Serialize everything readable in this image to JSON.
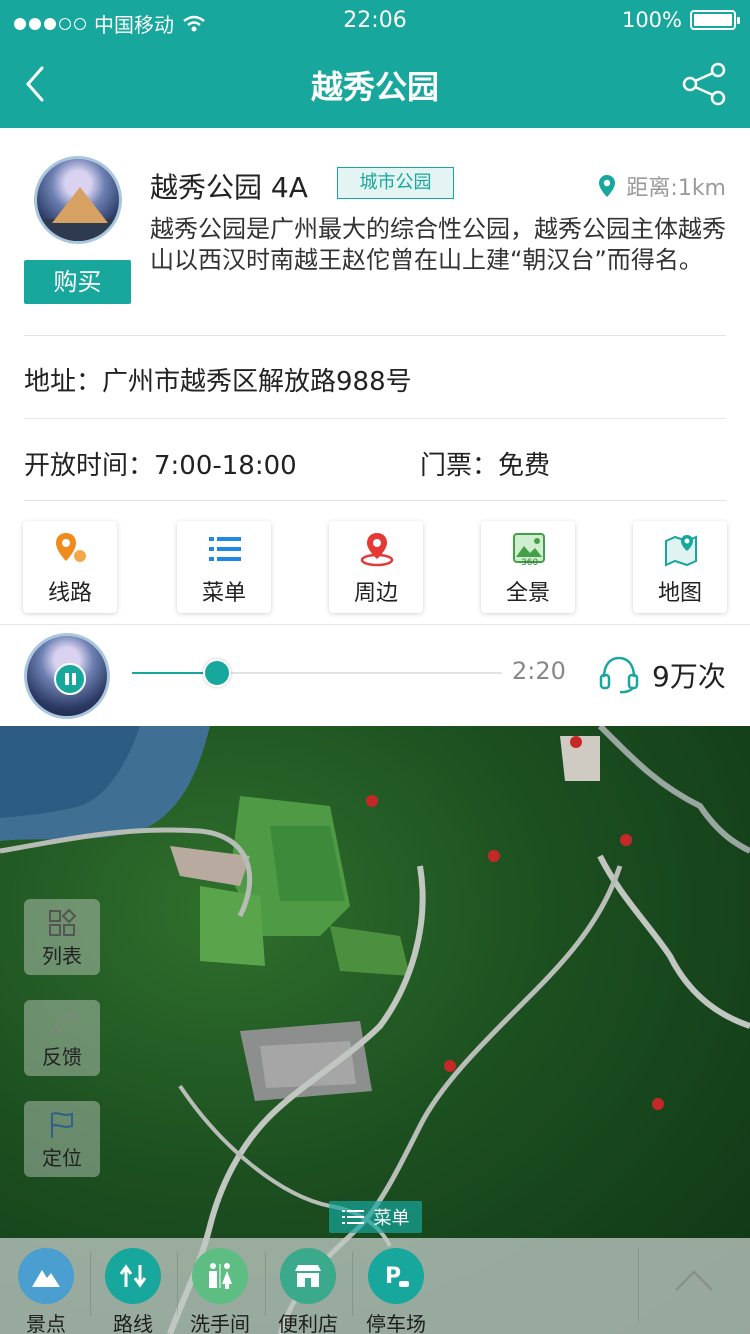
{
  "status_bar": {
    "carrier": "中国移动",
    "time": "22:06",
    "battery": "100%",
    "battery_level": 1.0
  },
  "nav": {
    "title": "越秀公园",
    "icons": {
      "back": "chevron-left-icon",
      "share": "share-icon"
    }
  },
  "poi": {
    "name": "越秀公园 4A",
    "tag": "城市公园",
    "distance": "距离:1km",
    "description": "越秀公园是广州最大的综合性公园，越秀公园主体越秀山以西汉时南越王赵佗曾在山上建“朝汉台”而得名。",
    "buy_label": "购买",
    "address": "地址：广州市越秀区解放路988号",
    "hours": "开放时间：7:00-18:00",
    "ticket": "门票：免费"
  },
  "actions": [
    {
      "label": "线路",
      "icon": "route-pin-icon",
      "color": "#f08a1c"
    },
    {
      "label": "菜单",
      "icon": "list-icon",
      "color": "#1e88e5"
    },
    {
      "label": "周边",
      "icon": "location-pin-icon",
      "color": "#e53935"
    },
    {
      "label": "全景",
      "icon": "panorama-360-icon",
      "color": "#43a047"
    },
    {
      "label": "地图",
      "icon": "map-icon",
      "color": "#17a79c"
    }
  ],
  "player": {
    "time": "2:20",
    "progress": 0.23,
    "plays": "9万次",
    "icons": {
      "pause": "pause-icon",
      "listen": "headphones-icon"
    }
  },
  "map": {
    "side_buttons": [
      {
        "label": "列表",
        "icon": "grid-list-icon"
      },
      {
        "label": "反馈",
        "icon": "pencil-icon"
      },
      {
        "label": "定位",
        "icon": "flag-icon"
      }
    ],
    "menu_chip": "菜单",
    "bottom_categories": [
      {
        "label": "景点",
        "icon": "mountain-icon",
        "color": "#4a9fd0"
      },
      {
        "label": "路线",
        "icon": "route-arrows-icon",
        "color": "#17a79c"
      },
      {
        "label": "洗手间",
        "icon": "restroom-icon",
        "color": "#5ebd83"
      },
      {
        "label": "便利店",
        "icon": "store-icon",
        "color": "#3aa98c"
      },
      {
        "label": "停车场",
        "icon": "parking-icon",
        "color": "#17a79c"
      }
    ]
  }
}
